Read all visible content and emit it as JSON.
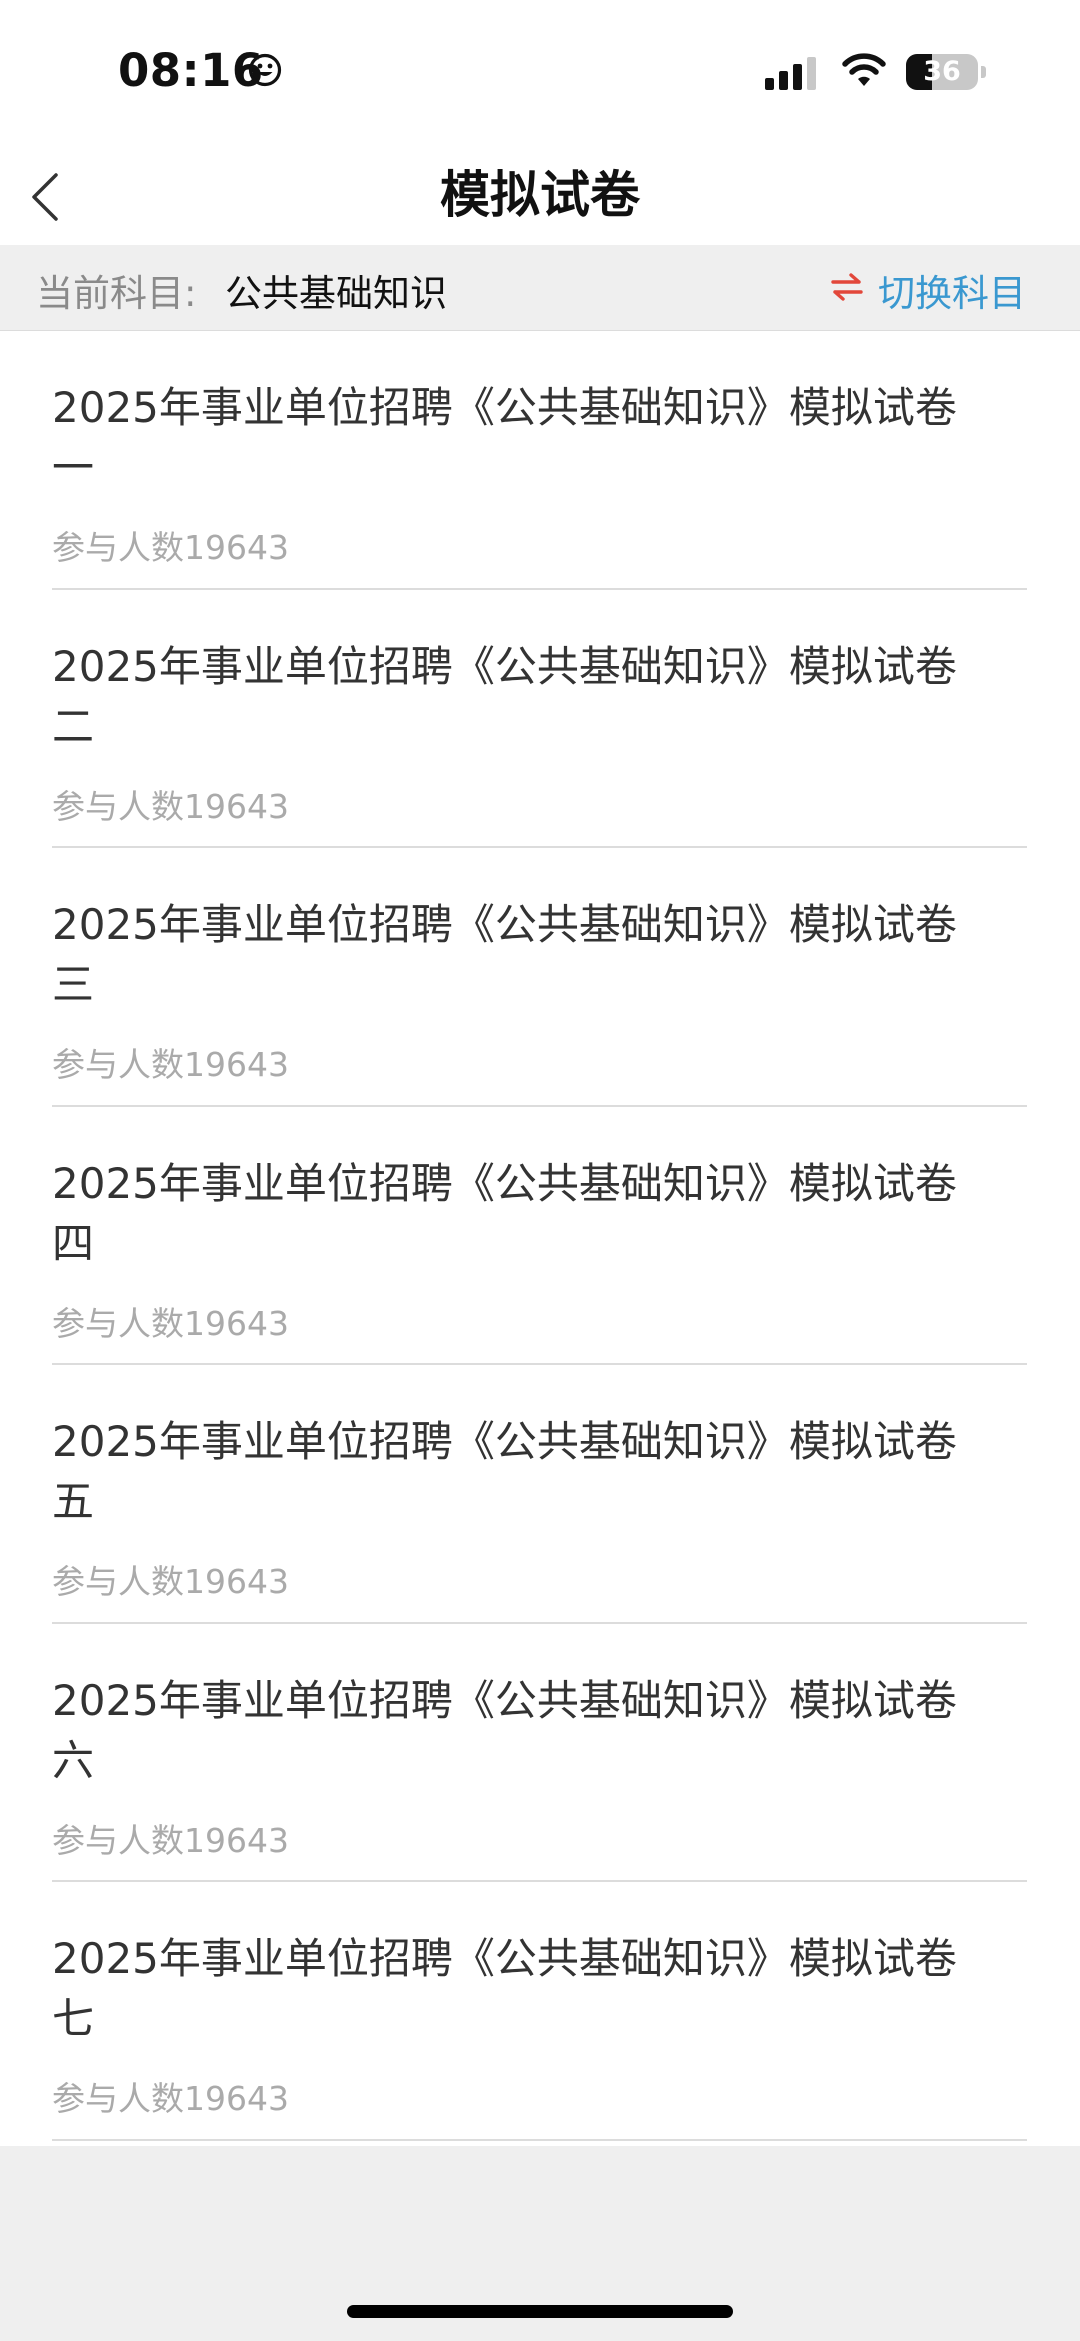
{
  "status_bar": {
    "time": "08:16",
    "battery_level": "36",
    "battery_fraction": 0.36
  },
  "header": {
    "title": "模拟试卷",
    "back_icon": "chevron-left-icon"
  },
  "subject": {
    "label": "当前科目:",
    "value": "公共基础知识",
    "switch_label": "切换科目",
    "switch_icon": "swap-arrows-icon",
    "accent_color": "#3a98d0",
    "icon_color": "#e2473a"
  },
  "papers": [
    {
      "title": "2025年事业单位招聘《公共基础知识》模拟试卷一",
      "participants": "参与人数19643"
    },
    {
      "title": "2025年事业单位招聘《公共基础知识》模拟试卷二",
      "participants": "参与人数19643"
    },
    {
      "title": "2025年事业单位招聘《公共基础知识》模拟试卷三",
      "participants": "参与人数19643"
    },
    {
      "title": "2025年事业单位招聘《公共基础知识》模拟试卷四",
      "participants": "参与人数19643"
    },
    {
      "title": "2025年事业单位招聘《公共基础知识》模拟试卷五",
      "participants": "参与人数19643"
    },
    {
      "title": "2025年事业单位招聘《公共基础知识》模拟试卷六",
      "participants": "参与人数19643"
    },
    {
      "title": "2025年事业单位招聘《公共基础知识》模拟试卷七",
      "participants": "参与人数19643"
    }
  ]
}
